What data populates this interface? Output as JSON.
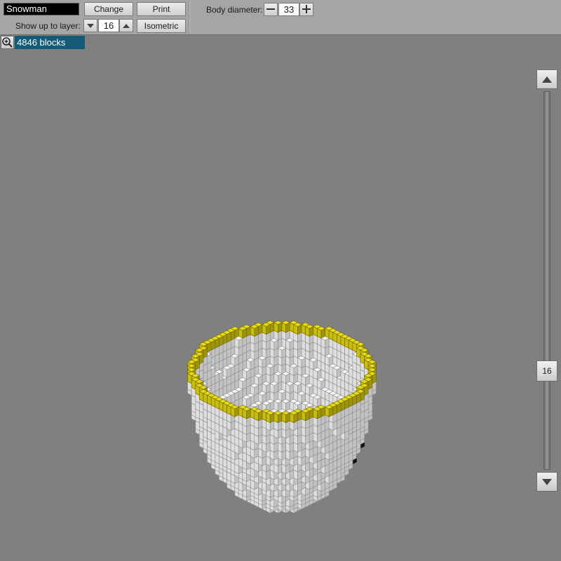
{
  "toolbar": {
    "shape_name": "Snowman",
    "change_label": "Change",
    "print_label": "Print",
    "layer_label": "Show up to layer:",
    "layer_value": "16",
    "view_label": "Isometric",
    "diameter_label": "Body diameter:",
    "diameter_value": "33"
  },
  "status": {
    "block_count": "4846 blocks"
  },
  "slider": {
    "value": "16",
    "max_layer": 16
  },
  "icons": {
    "zoom": "zoom-in-icon",
    "down": "triangle-down-icon",
    "up": "triangle-up-icon",
    "minus": "minus-icon",
    "plus": "plus-icon"
  },
  "colors": {
    "background": "#808080",
    "toolbar": "#a5a5a5",
    "rim_block": "#e9dc16",
    "snow_block": "#f4f4f4",
    "dark_block": "#1b1b2c",
    "selection": "#135b78"
  }
}
